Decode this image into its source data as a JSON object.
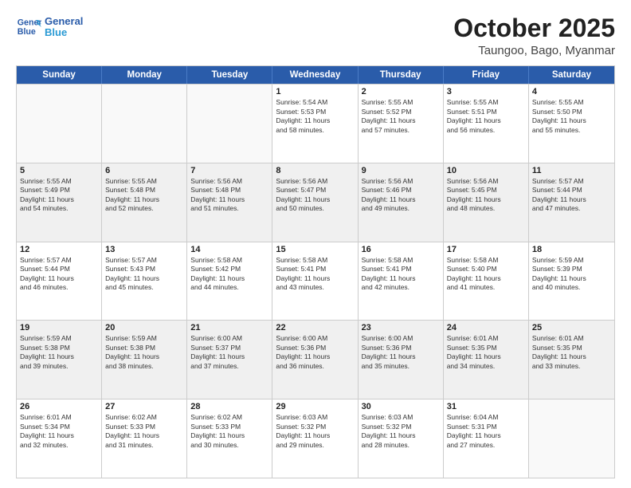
{
  "logo": {
    "line1": "General",
    "line2": "Blue"
  },
  "title": "October 2025",
  "subtitle": "Taungoo, Bago, Myanmar",
  "weekdays": [
    "Sunday",
    "Monday",
    "Tuesday",
    "Wednesday",
    "Thursday",
    "Friday",
    "Saturday"
  ],
  "weeks": [
    [
      {
        "day": "",
        "info": ""
      },
      {
        "day": "",
        "info": ""
      },
      {
        "day": "",
        "info": ""
      },
      {
        "day": "1",
        "info": "Sunrise: 5:54 AM\nSunset: 5:53 PM\nDaylight: 11 hours\nand 58 minutes."
      },
      {
        "day": "2",
        "info": "Sunrise: 5:55 AM\nSunset: 5:52 PM\nDaylight: 11 hours\nand 57 minutes."
      },
      {
        "day": "3",
        "info": "Sunrise: 5:55 AM\nSunset: 5:51 PM\nDaylight: 11 hours\nand 56 minutes."
      },
      {
        "day": "4",
        "info": "Sunrise: 5:55 AM\nSunset: 5:50 PM\nDaylight: 11 hours\nand 55 minutes."
      }
    ],
    [
      {
        "day": "5",
        "info": "Sunrise: 5:55 AM\nSunset: 5:49 PM\nDaylight: 11 hours\nand 54 minutes."
      },
      {
        "day": "6",
        "info": "Sunrise: 5:55 AM\nSunset: 5:48 PM\nDaylight: 11 hours\nand 52 minutes."
      },
      {
        "day": "7",
        "info": "Sunrise: 5:56 AM\nSunset: 5:48 PM\nDaylight: 11 hours\nand 51 minutes."
      },
      {
        "day": "8",
        "info": "Sunrise: 5:56 AM\nSunset: 5:47 PM\nDaylight: 11 hours\nand 50 minutes."
      },
      {
        "day": "9",
        "info": "Sunrise: 5:56 AM\nSunset: 5:46 PM\nDaylight: 11 hours\nand 49 minutes."
      },
      {
        "day": "10",
        "info": "Sunrise: 5:56 AM\nSunset: 5:45 PM\nDaylight: 11 hours\nand 48 minutes."
      },
      {
        "day": "11",
        "info": "Sunrise: 5:57 AM\nSunset: 5:44 PM\nDaylight: 11 hours\nand 47 minutes."
      }
    ],
    [
      {
        "day": "12",
        "info": "Sunrise: 5:57 AM\nSunset: 5:44 PM\nDaylight: 11 hours\nand 46 minutes."
      },
      {
        "day": "13",
        "info": "Sunrise: 5:57 AM\nSunset: 5:43 PM\nDaylight: 11 hours\nand 45 minutes."
      },
      {
        "day": "14",
        "info": "Sunrise: 5:58 AM\nSunset: 5:42 PM\nDaylight: 11 hours\nand 44 minutes."
      },
      {
        "day": "15",
        "info": "Sunrise: 5:58 AM\nSunset: 5:41 PM\nDaylight: 11 hours\nand 43 minutes."
      },
      {
        "day": "16",
        "info": "Sunrise: 5:58 AM\nSunset: 5:41 PM\nDaylight: 11 hours\nand 42 minutes."
      },
      {
        "day": "17",
        "info": "Sunrise: 5:58 AM\nSunset: 5:40 PM\nDaylight: 11 hours\nand 41 minutes."
      },
      {
        "day": "18",
        "info": "Sunrise: 5:59 AM\nSunset: 5:39 PM\nDaylight: 11 hours\nand 40 minutes."
      }
    ],
    [
      {
        "day": "19",
        "info": "Sunrise: 5:59 AM\nSunset: 5:38 PM\nDaylight: 11 hours\nand 39 minutes."
      },
      {
        "day": "20",
        "info": "Sunrise: 5:59 AM\nSunset: 5:38 PM\nDaylight: 11 hours\nand 38 minutes."
      },
      {
        "day": "21",
        "info": "Sunrise: 6:00 AM\nSunset: 5:37 PM\nDaylight: 11 hours\nand 37 minutes."
      },
      {
        "day": "22",
        "info": "Sunrise: 6:00 AM\nSunset: 5:36 PM\nDaylight: 11 hours\nand 36 minutes."
      },
      {
        "day": "23",
        "info": "Sunrise: 6:00 AM\nSunset: 5:36 PM\nDaylight: 11 hours\nand 35 minutes."
      },
      {
        "day": "24",
        "info": "Sunrise: 6:01 AM\nSunset: 5:35 PM\nDaylight: 11 hours\nand 34 minutes."
      },
      {
        "day": "25",
        "info": "Sunrise: 6:01 AM\nSunset: 5:35 PM\nDaylight: 11 hours\nand 33 minutes."
      }
    ],
    [
      {
        "day": "26",
        "info": "Sunrise: 6:01 AM\nSunset: 5:34 PM\nDaylight: 11 hours\nand 32 minutes."
      },
      {
        "day": "27",
        "info": "Sunrise: 6:02 AM\nSunset: 5:33 PM\nDaylight: 11 hours\nand 31 minutes."
      },
      {
        "day": "28",
        "info": "Sunrise: 6:02 AM\nSunset: 5:33 PM\nDaylight: 11 hours\nand 30 minutes."
      },
      {
        "day": "29",
        "info": "Sunrise: 6:03 AM\nSunset: 5:32 PM\nDaylight: 11 hours\nand 29 minutes."
      },
      {
        "day": "30",
        "info": "Sunrise: 6:03 AM\nSunset: 5:32 PM\nDaylight: 11 hours\nand 28 minutes."
      },
      {
        "day": "31",
        "info": "Sunrise: 6:04 AM\nSunset: 5:31 PM\nDaylight: 11 hours\nand 27 minutes."
      },
      {
        "day": "",
        "info": ""
      }
    ]
  ]
}
